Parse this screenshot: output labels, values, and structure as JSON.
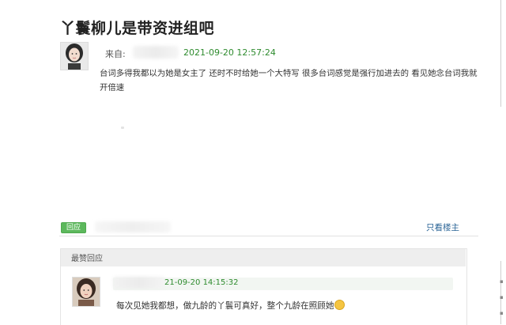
{
  "post": {
    "title": "丫鬟柳儿是带资进组吧",
    "source_label": "来自:",
    "time": "2021-09-20 12:57:24",
    "content": "台词多得我都以为她是女主了 还时不时给她一个大特写 很多台词感觉是强行加进去的 看见她念台词我就开倍速"
  },
  "actions": {
    "reply_label": "回应",
    "only_author_label": "只看楼主"
  },
  "best_replies": {
    "header": "最赞回应",
    "items": [
      {
        "time": "21-09-20 14:15:32",
        "text": "每次见她我都想，做九龄的丫鬟可真好，整个九龄在照顾她",
        "emoji": "smile-emoji"
      }
    ]
  },
  "colors": {
    "accent_green": "#5cb85c",
    "time_green": "#2e8b2e",
    "link_blue": "#2a6496"
  }
}
